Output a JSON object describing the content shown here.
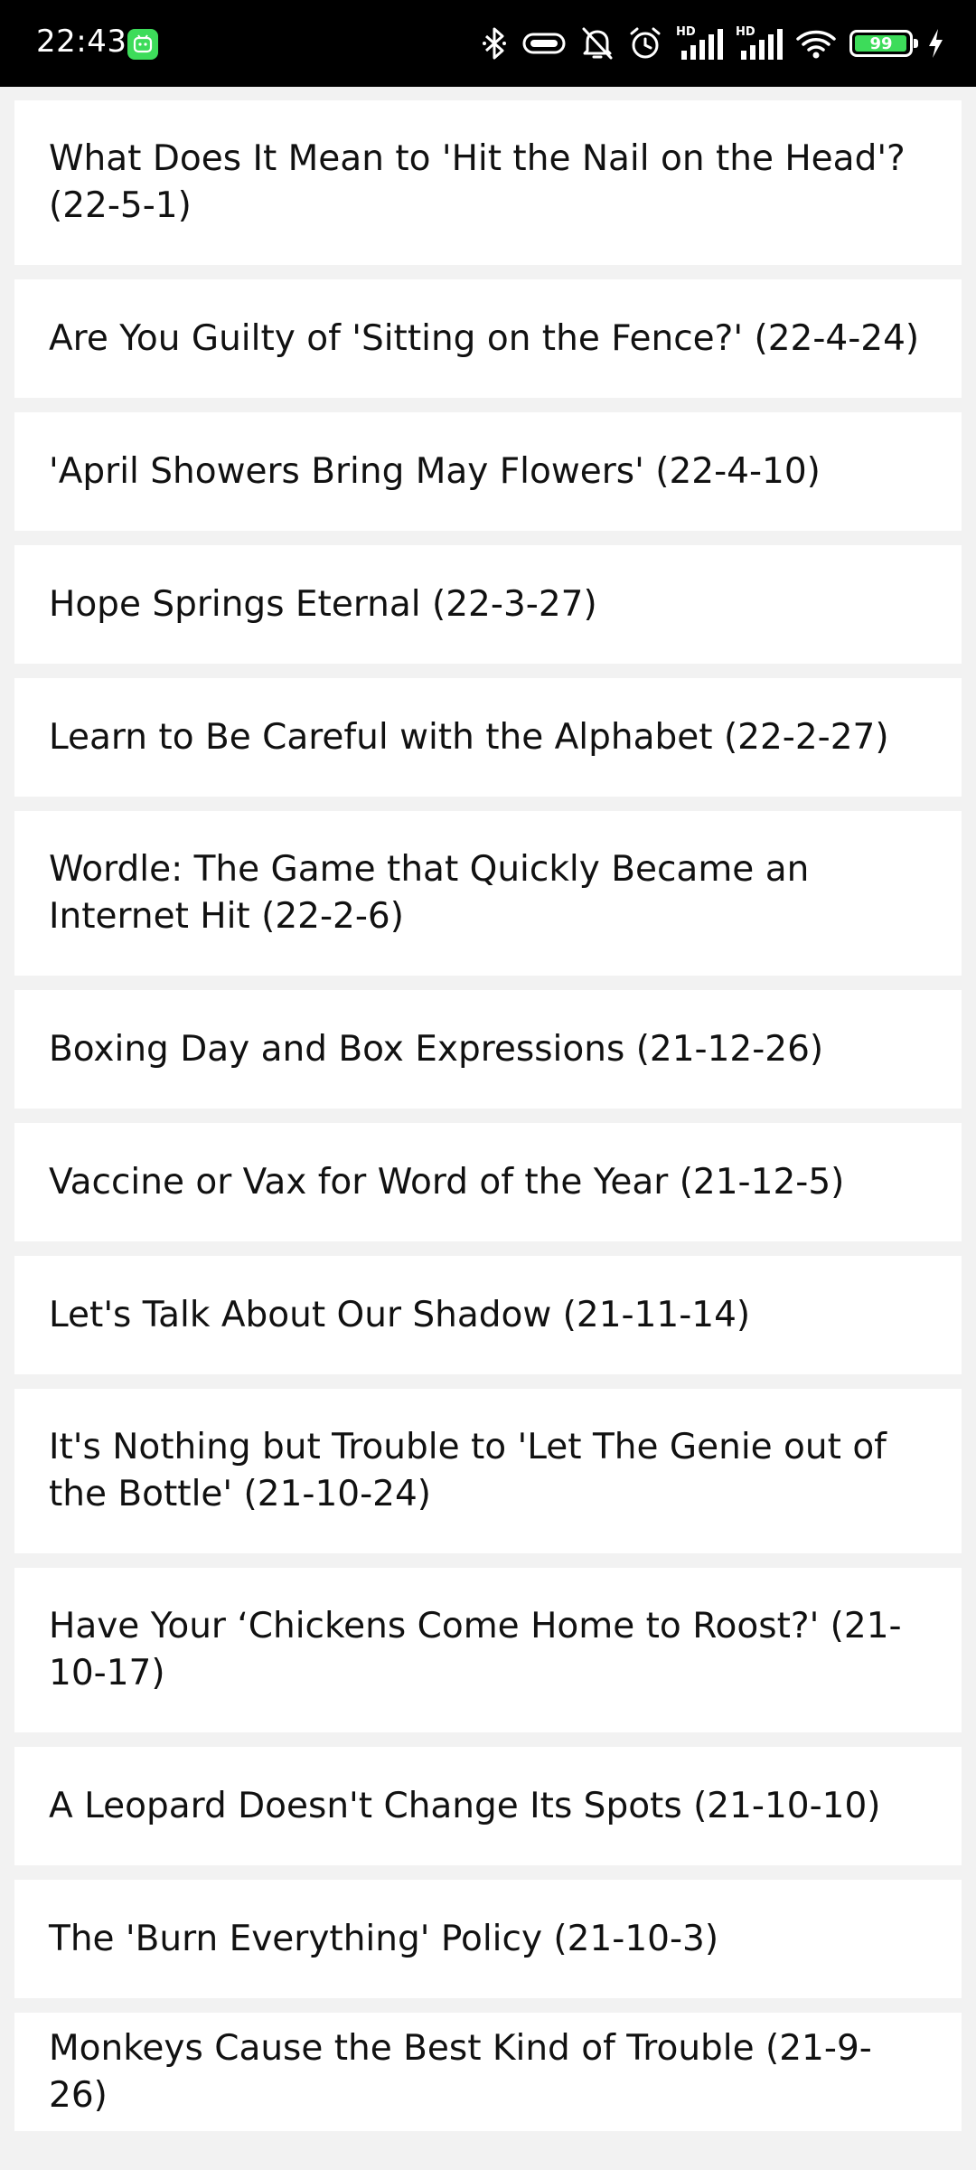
{
  "status_bar": {
    "time": "22:43",
    "battery": "99",
    "icons": [
      "bluetooth-icon",
      "vibrate-icon",
      "mute-icon",
      "alarm-icon",
      "hd-signal-icon",
      "hd-signal-icon",
      "wifi-icon",
      "battery-icon",
      "charging-icon"
    ],
    "hd_label": "HD",
    "accent_color": "#3ddc5a"
  },
  "articles": [
    {
      "title": " What Does It Mean to 'Hit the Nail on the Head'? (22-5-1)"
    },
    {
      "title": " Are You Guilty of 'Sitting on the Fence?' (22-4-24)"
    },
    {
      "title": " 'April Showers Bring May Flowers' (22-4-10)"
    },
    {
      "title": " Hope Springs Eternal (22-3-27)"
    },
    {
      "title": " Learn to Be Careful with the Alphabet (22-2-27)"
    },
    {
      "title": " Wordle: The Game that Quickly Became an Internet Hit (22-2-6)"
    },
    {
      "title": " Boxing Day and Box Expressions (21-12-26)"
    },
    {
      "title": " Vaccine or Vax for Word of the Year (21-12-5)"
    },
    {
      "title": " Let's Talk About Our Shadow (21-11-14)"
    },
    {
      "title": " It's Nothing but Trouble to 'Let The Genie out of the Bottle' (21-10-24)"
    },
    {
      "title": " Have Your ‘Chickens Come Home to Roost?' (21-10-17)"
    },
    {
      "title": " A Leopard Doesn't Change Its Spots (21-10-10)"
    },
    {
      "title": " The 'Burn Everything' Policy (21-10-3)"
    },
    {
      "title": " Monkeys Cause the Best Kind of Trouble (21-9-26)"
    }
  ]
}
